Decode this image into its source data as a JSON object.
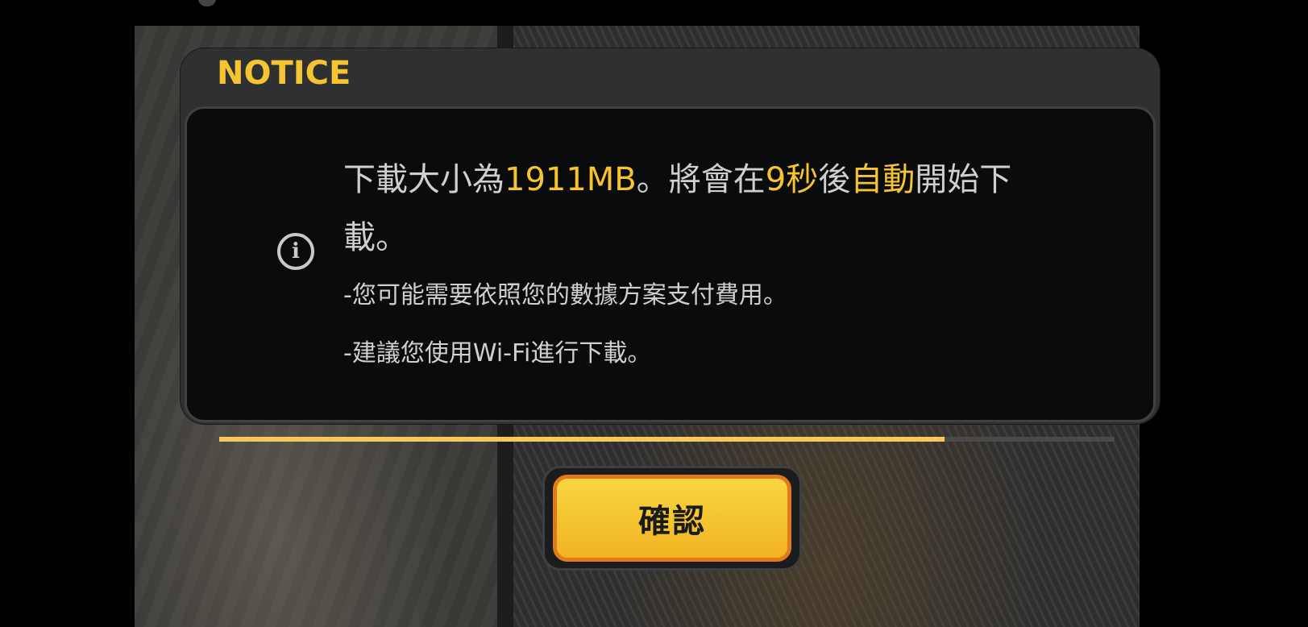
{
  "dialog": {
    "title": "NOTICE",
    "icon": "info-icon",
    "message": {
      "part1": "下載大小為",
      "size": "1911MB",
      "part2": "。將會在",
      "seconds": "9秒",
      "part3": "後",
      "auto": "自動",
      "part4": "開始下載。"
    },
    "note1": "-您可能需要依照您的數據方案支付費用。",
    "note2": "-建議您使用Wi-Fi進行下載。"
  },
  "progress": {
    "value": 0.81
  },
  "confirm": {
    "label": "確認"
  },
  "colors": {
    "accent": "#f6c432",
    "dialog_bg": "#2f3031",
    "body_bg": "#0a0b0c",
    "button_border": "#e07a1c"
  }
}
